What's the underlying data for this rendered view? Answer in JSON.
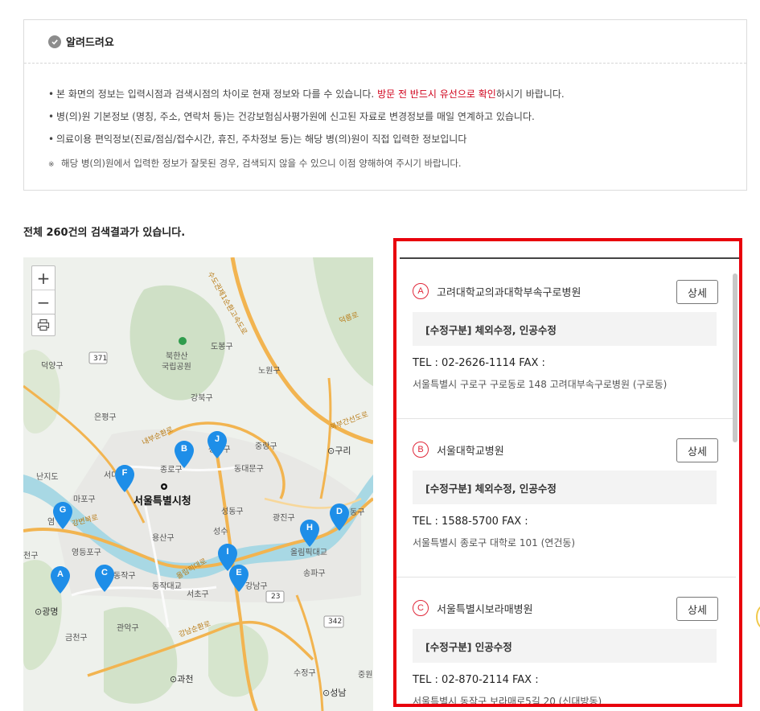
{
  "notice": {
    "title": "알려드려요",
    "line1_pre": "본 화면의 정보는 입력시점과 검색시점의 차이로 현재 정보와 다를 수 있습니다. ",
    "line1_em": "방문 전 반드시 유선으로 확인",
    "line1_post": "하시기 바랍니다.",
    "line2": "병(의)원 기본정보 (명칭, 주소, 연락처 등)는 건강보험심사평가원에 신고된 자료로 변경정보를 매일 연계하고 있습니다.",
    "line3": "의료이용 편익정보(진료/점심/접수시간, 휴진, 주차정보 등)는 해당 병(의)원이 직접 입력한 정보입니다",
    "line4_mark": "※",
    "line4": "해당 병(의)원에서 입력한 정보가 잘못된 경우, 검색되지 않을 수 있으니 이점 양해하여 주시기 바랍니다.",
    "bullet": "•"
  },
  "result": {
    "text": "전체 260건의 검색결과가 있습니다."
  },
  "map": {
    "zoom_in": "+",
    "zoom_out": "−",
    "labels": {
      "bukhansan": "북한산",
      "national_park": "국립공원",
      "dobong": "도봉구",
      "nowon": "노원구",
      "gangbuk": "강북구",
      "eunpyeong": "은평구",
      "seongbuk": "성북구",
      "jungnang": "중랑구",
      "guri": "⊙구리",
      "jongno": "종로구",
      "dongdaemun": "동대문구",
      "seodaemun": "서대문구",
      "seoul_city_hall": "서울특별시청",
      "mapo": "마포구",
      "seongdong": "성동구",
      "gwangjin": "광진구",
      "yongsan": "용산구",
      "yeongdeungpo": "영등포구",
      "dongjak": "동작구",
      "seocho": "서초구",
      "gangnam": "강남구",
      "songpa": "송파구",
      "olympic": "올림픽대교",
      "gwanak": "관악구",
      "geumcheon": "금천구",
      "gwangmyeong": "⊙광명",
      "gwacheon": "⊙과천",
      "seongnam": "⊙성남",
      "sujeong": "수정구",
      "deogyang": "덕양구",
      "nanji": "난지도",
      "dongjak_bridge": "동작대교",
      "r371": "371",
      "r23": "23",
      "r342": "342",
      "dong": "동구",
      "cheon": "천구",
      "yeom": "염",
      "jung": "중원",
      "seongsu": "성수",
      "wonbuk": "원",
      "gangbyeon": "강변북로",
      "olympic_ro": "올림픽대로",
      "gangnam_sunhwan": "강남순환로",
      "sudo_ring": "수도권제1순환고속도로",
      "bukbu": "북부간선도로",
      "naebu": "내부순환로",
      "deokneung": "덕릉로"
    },
    "markers": [
      "A",
      "B",
      "C",
      "D",
      "E",
      "F",
      "G",
      "H",
      "I",
      "J"
    ],
    "marker_color": "#1e8ee8"
  },
  "list": {
    "items": [
      {
        "letter": "A",
        "name": "고려대학교의과대학부속구로병원",
        "detail": "상세",
        "revision": "[수정구분] 체외수정, 인공수정",
        "tel": "TEL : 02-2626-1114   FAX :",
        "address": "서울특별시 구로구 구로동로 148 고려대부속구로병원 (구로동)"
      },
      {
        "letter": "B",
        "name": "서울대학교병원",
        "detail": "상세",
        "revision": "[수정구분] 체외수정, 인공수정",
        "tel": "TEL : 1588-5700   FAX :",
        "address": "서울특별시 종로구 대학로 101 (연건동)"
      },
      {
        "letter": "C",
        "name": "서울특별시보라매병원",
        "detail": "상세",
        "revision": "[수정구분] 인공수정",
        "tel": "TEL : 02-870-2114   FAX :",
        "address": "서울특별시 동작구 보라매로5길 20 (신대방동)"
      }
    ]
  },
  "colors": {
    "accent_red": "#e8000c",
    "emphasis_red": "#d0021b",
    "marker_blue": "#1e8ee8"
  }
}
